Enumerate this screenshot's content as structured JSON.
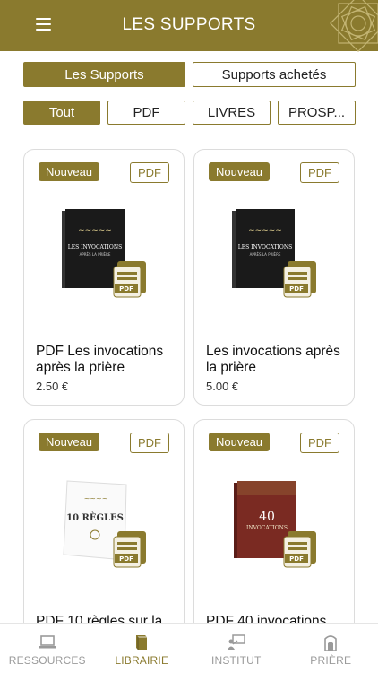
{
  "header": {
    "title": "LES SUPPORTS"
  },
  "segments": {
    "items": [
      "Les Supports",
      "Supports achetés"
    ],
    "active": 0
  },
  "filters": {
    "items": [
      "Tout",
      "PDF",
      "LIVRES",
      "PROSP..."
    ],
    "active": 0
  },
  "products": [
    {
      "badge": "Nouveau",
      "type": "PDF",
      "title": "PDF Les invocations après la prière",
      "price": "2.50 €",
      "cover": "book-black-invocations"
    },
    {
      "badge": "Nouveau",
      "type": "PDF",
      "title": "Les invocations après la prière",
      "price": "5.00 €",
      "cover": "book-black-invocations"
    },
    {
      "badge": "Nouveau",
      "type": "PDF",
      "title": "PDF 10 règles sur la",
      "price": "",
      "cover": "book-white-10-regles"
    },
    {
      "badge": "Nouveau",
      "type": "PDF",
      "title": "PDF 40 invocations",
      "price": "",
      "cover": "book-red-40-invocations"
    }
  ],
  "bottom_nav": {
    "items": [
      {
        "label": "RESSOURCES",
        "icon": "laptop-icon"
      },
      {
        "label": "LIBRAIRIE",
        "icon": "book-icon"
      },
      {
        "label": "INSTITUT",
        "icon": "teacher-board-icon"
      },
      {
        "label": "PRIÈRE",
        "icon": "mosque-icon"
      }
    ],
    "active": 1
  },
  "colors": {
    "accent": "#8a7a2e",
    "text": "#111111",
    "muted": "#9a9a9a"
  }
}
